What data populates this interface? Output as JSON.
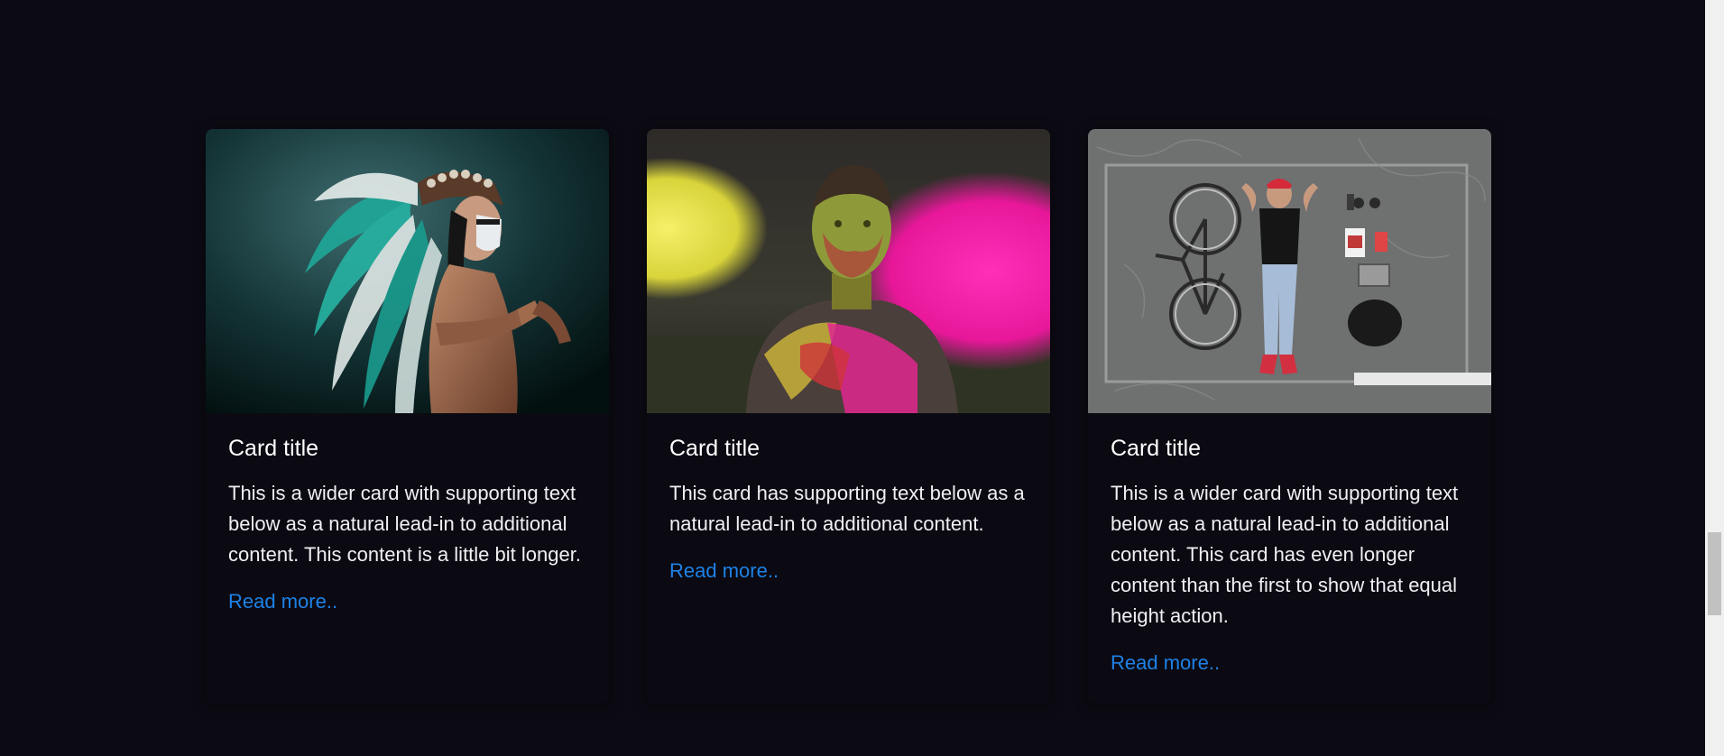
{
  "cards": [
    {
      "image": "man-in-feathered-headdress-photo",
      "title": "Card title",
      "text": "This is a wider card with supporting text below as a natural lead-in to additional content. This content is a little bit longer.",
      "link": "Read more.."
    },
    {
      "image": "man-in-color-powder-photo",
      "title": "Card title",
      "text": "This card has supporting text below as a natural lead-in to additional content.",
      "link": "Read more.."
    },
    {
      "image": "man-lying-beside-bicycle-photo",
      "title": "Card title",
      "text": "This is a wider card with supporting text below as a natural lead-in to additional content. This card has even longer content than the first to show that equal height action.",
      "link": "Read more.."
    }
  ],
  "colors": {
    "background": "#0c0b14",
    "card": "#0b0a13",
    "link": "#1e82e6",
    "text": "#f0f0f3"
  }
}
